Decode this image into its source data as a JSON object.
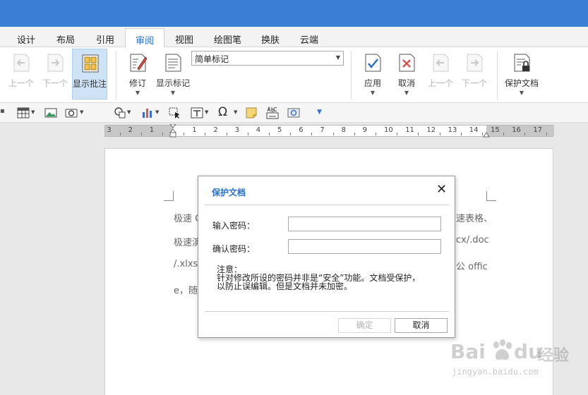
{
  "menubar": {
    "tabs": [
      {
        "label": "设计"
      },
      {
        "label": "布局"
      },
      {
        "label": "引用"
      },
      {
        "label": "审阅"
      },
      {
        "label": "视图"
      },
      {
        "label": "绘图笔"
      },
      {
        "label": "换肤"
      },
      {
        "label": "云端"
      }
    ],
    "active_tab": "审阅"
  },
  "ribbon": {
    "buttons": [
      {
        "label": "上一个",
        "icon": "arrow-left-icon",
        "enabled": false
      },
      {
        "label": "下一个",
        "icon": "arrow-right-icon",
        "enabled": false
      },
      {
        "label": "显示批注",
        "icon": "show-comments-icon",
        "enabled": true,
        "selected": true
      },
      {
        "label": "修订",
        "icon": "track-changes-icon",
        "enabled": true
      },
      {
        "label": "显示标记",
        "icon": "show-markup-icon",
        "enabled": true
      },
      {
        "label": "应用",
        "icon": "accept-icon",
        "enabled": true
      },
      {
        "label": "取消",
        "icon": "reject-icon",
        "enabled": true
      },
      {
        "label": "上一个",
        "icon": "arrow-left-icon",
        "enabled": false
      },
      {
        "label": "下一个",
        "icon": "arrow-right-icon",
        "enabled": false
      },
      {
        "label": "保护文档",
        "icon": "protect-document-icon",
        "enabled": true
      }
    ],
    "markup_dropdown": "简单标记"
  },
  "toolbar2": {
    "icons": [
      "table-icon",
      "picture-icon",
      "screenshot-icon",
      "shapes-icon",
      "chart-icon",
      "select-icon",
      "textbox-icon",
      "symbol-icon",
      "note-icon",
      "field-icon",
      "media-icon",
      "more-icon"
    ]
  },
  "ruler": {
    "labels": [
      "3",
      "2",
      "1",
      "1",
      "2",
      "3",
      "4",
      "5",
      "6",
      "7",
      "8",
      "9",
      "10",
      "11",
      "12",
      "13",
      "14",
      "15",
      "16",
      "17"
    ]
  },
  "document": {
    "lines": [
      {
        "left": "极速 C",
        "right": "速表格、"
      },
      {
        "left": "极速演",
        "right": "cx/.doc"
      },
      {
        "left": "/.xlxs/",
        "right": "公 offic"
      },
      {
        "left": "e，随",
        "right": ""
      }
    ]
  },
  "dialog": {
    "title": "保护文档",
    "close_symbol": "✕",
    "password_label": "输入密码：",
    "confirm_label": "确认密码：",
    "password_value": "",
    "confirm_value": "",
    "note_title": "注意：",
    "note_line1": "针对修改所设的密码并非是“安全”功能。文档受保护，",
    "note_line2": "以防止误编辑。但是文档并未加密。",
    "ok_label": "确定",
    "cancel_label": "取消"
  },
  "watermark": {
    "brand_text": "Bai",
    "brand_text2": "du",
    "site_label": "经验",
    "url": "jingyan.baidu.com"
  },
  "colors": {
    "title_bar": "#3a7fd5",
    "active_tab_text": "#2b6fc9",
    "dialog_title": "#2b6fc9",
    "selected_button": "#cfe3f7"
  }
}
